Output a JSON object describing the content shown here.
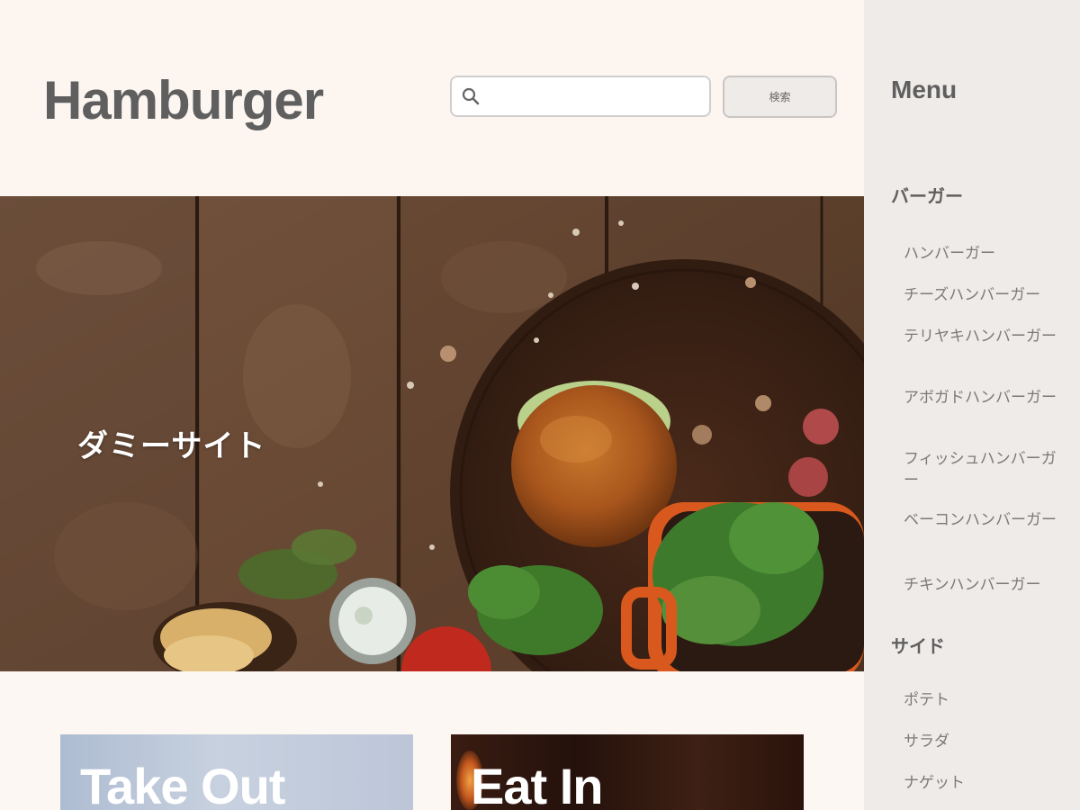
{
  "header": {
    "site_title": "Hamburger",
    "search": {
      "value": "",
      "placeholder": ""
    },
    "search_button_label": "検索"
  },
  "hero": {
    "text": "ダミーサイト"
  },
  "cards": [
    {
      "title": "Take Out"
    },
    {
      "title": "Eat In"
    }
  ],
  "sidebar": {
    "title": "Menu",
    "categories": [
      {
        "label": "バーガー",
        "items": [
          "ハンバーガー",
          "チーズハンバーガー",
          "テリヤキハンバーガー",
          "アボガドハンバーガー",
          "フィッシュハンバーガー",
          "ベーコンハンバーガー",
          "チキンハンバーガー"
        ]
      },
      {
        "label": "サイド",
        "items": [
          "ポテト",
          "サラダ",
          "ナゲット"
        ]
      }
    ]
  },
  "colors": {
    "page_background": "#fdf7f3",
    "sidebar_background": "#efebe8",
    "title_text": "#5f5f5f",
    "sidebar_item_text": "#7a7a7a"
  }
}
